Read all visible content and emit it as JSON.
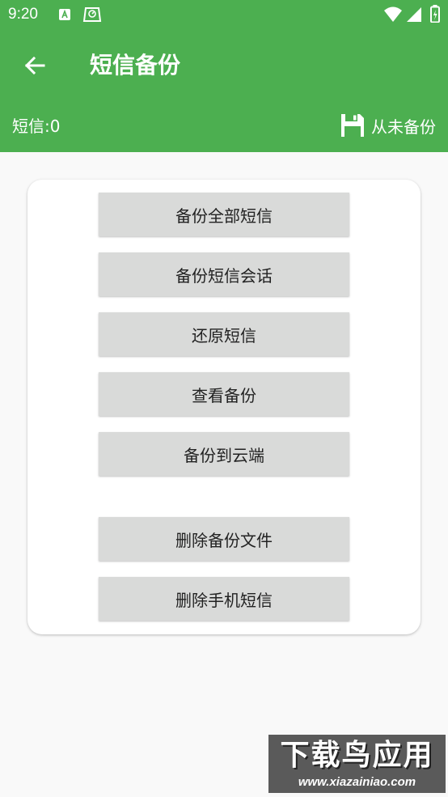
{
  "status_bar": {
    "time": "9:20"
  },
  "toolbar": {
    "title": "短信备份"
  },
  "summary": {
    "sms_count": "短信:0",
    "backup_status": "从未备份"
  },
  "actions": [
    {
      "label": "备份全部短信"
    },
    {
      "label": "备份短信会话"
    },
    {
      "label": "还原短信"
    },
    {
      "label": "查看备份"
    },
    {
      "label": "备份到云端"
    },
    {
      "label": "删除备份文件"
    },
    {
      "label": "删除手机短信"
    }
  ],
  "watermark": {
    "title": "下载鸟应用",
    "url": "www.xiazainiao.com"
  },
  "colors": {
    "primary": "#4caf50",
    "button": "#d9dad9",
    "background": "#f9f9f9"
  }
}
